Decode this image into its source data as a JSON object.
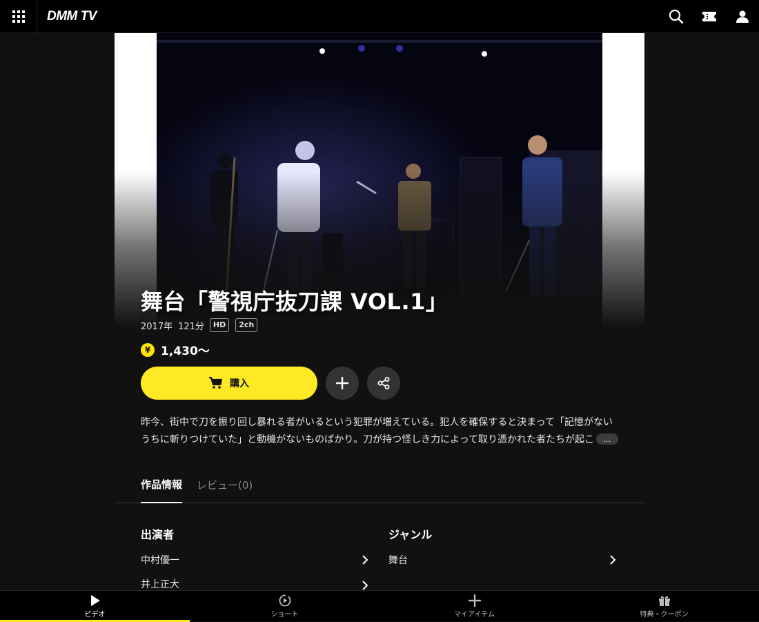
{
  "header": {
    "logo": "DMM TV",
    "icons": [
      "menu-grid-icon",
      "search-icon",
      "ticket-icon",
      "user-icon"
    ]
  },
  "title": {
    "main": "舞台「警視庁抜刀課 VOL.1」"
  },
  "meta": {
    "year": "2017年",
    "duration": "121分",
    "tags": [
      "HD",
      "2ch"
    ]
  },
  "price": {
    "symbol": "¥",
    "value": "1,430〜"
  },
  "actions": {
    "buy_label": "購入"
  },
  "description": {
    "line1": "昨今、街中で刀を振り回し暴れる者がいるという犯罪が増えている。犯人を確保すると決まって「記憶がない",
    "line2": "うちに斬りつけていた」と動機がないものばかり。刀が持つ怪しき力によって取り憑かれた者たちが起こ",
    "more_label": "…"
  },
  "tabs": [
    {
      "label": "作品情報",
      "active": true
    },
    {
      "label": "レビュー(0)",
      "active": false
    }
  ],
  "cast": {
    "title": "出演者",
    "items": [
      "中村優一",
      "井上正大"
    ]
  },
  "genre": {
    "title": "ジャンル",
    "items": [
      "舞台"
    ]
  },
  "bottom_nav": [
    {
      "label": "ビデオ",
      "icon": "play-icon",
      "active": true
    },
    {
      "label": "ショート",
      "icon": "short-icon",
      "active": false
    },
    {
      "label": "マイアイテム",
      "icon": "plus-icon",
      "active": false
    },
    {
      "label": "特典・クーポン",
      "icon": "gift-icon",
      "active": false
    }
  ],
  "colors": {
    "accent": "#ffe925",
    "background": "#111111"
  }
}
